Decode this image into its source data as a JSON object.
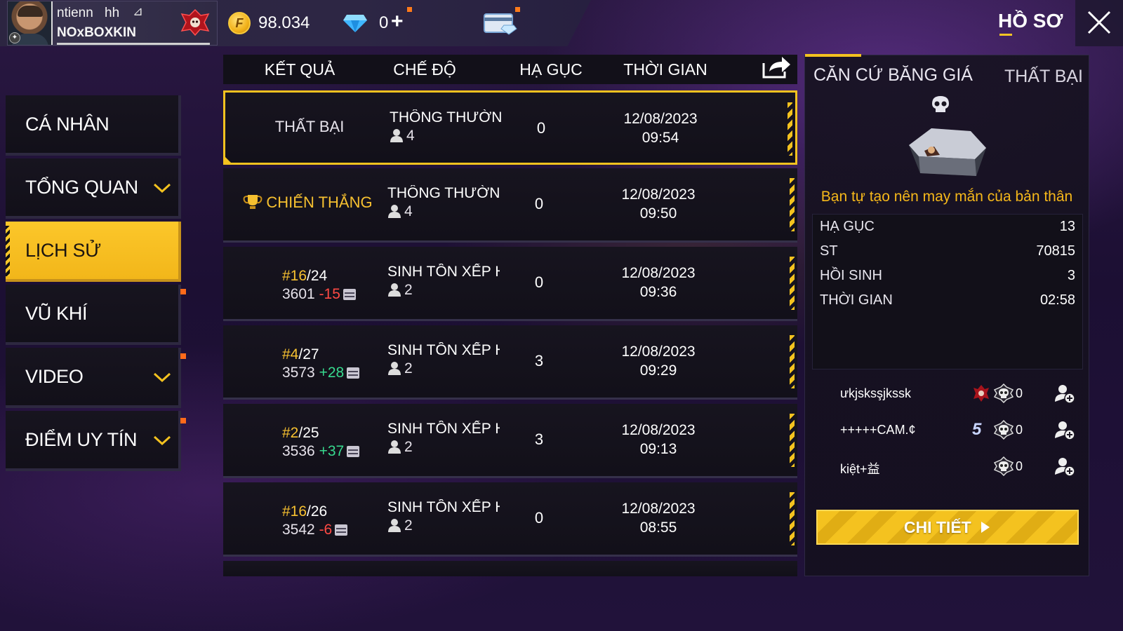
{
  "profile": {
    "name_line1": "ntienn",
    "tag": "hh",
    "name_line2": "NOxBOXKIN"
  },
  "currency": {
    "gold_symbol": "F",
    "gold": "98.034",
    "diamonds": "0",
    "plus": "+"
  },
  "header": {
    "title": "HỒ SƠ"
  },
  "colors": {
    "accent": "#f4c21f",
    "win": "#f6c030",
    "loss_delta": "#ff4a44",
    "gain_delta": "#37d98e"
  },
  "sidebar": {
    "items": [
      {
        "label": "CÁ NHÂN",
        "has_chevron": false,
        "active": false
      },
      {
        "label": "TỔNG QUAN",
        "has_chevron": true,
        "active": false
      },
      {
        "label": "LỊCH SỬ",
        "has_chevron": false,
        "active": true
      },
      {
        "label": "VŨ KHÍ",
        "has_chevron": false,
        "active": false
      },
      {
        "label": "VIDEO",
        "has_chevron": true,
        "active": false
      },
      {
        "label": "ĐIỂM UY TÍN",
        "has_chevron": true,
        "active": false
      }
    ]
  },
  "table": {
    "headers": {
      "result": "KẾT QUẢ",
      "mode": "CHẾ ĐỘ",
      "kills": "HẠ GỤC",
      "time": "THỜI GIAN"
    },
    "rows": [
      {
        "result": "THẤT BẠI",
        "mode": "THÔNG THƯỜNG-SINH TỒN",
        "players": "4",
        "kills": "0",
        "date": "12/08/2023",
        "time": "09:54"
      },
      {
        "result": "CHIẾN THẮNG",
        "mode": "THÔNG THƯỜNG-SINH TỒN",
        "players": "4",
        "kills": "0",
        "date": "12/08/2023",
        "time": "09:50"
      },
      {
        "rank": "#16",
        "total": "/24",
        "points": "3601",
        "delta": "-15",
        "mode": "SINH TỒN XẾP HẠNG",
        "players": "2",
        "kills": "0",
        "date": "12/08/2023",
        "time": "09:36"
      },
      {
        "rank": "#4",
        "total": "/27",
        "points": "3573",
        "delta": "+28",
        "mode": "SINH TỒN XẾP HẠNG",
        "players": "2",
        "kills": "3",
        "date": "12/08/2023",
        "time": "09:29"
      },
      {
        "rank": "#2",
        "total": "/25",
        "points": "3536",
        "delta": "+37",
        "mode": "SINH TỒN XẾP HẠNG",
        "players": "2",
        "kills": "3",
        "date": "12/08/2023",
        "time": "09:13"
      },
      {
        "rank": "#16",
        "total": "/26",
        "points": "3542",
        "delta": "-6",
        "mode": "SINH TỒN XẾP HẠNG",
        "players": "2",
        "kills": "0",
        "date": "12/08/2023",
        "time": "08:55"
      }
    ]
  },
  "match_detail": {
    "map": "CĂN CỨ BĂNG GIÁ",
    "result": "THẤT BẠI",
    "message": "Bạn tự tạo nên may mắn của bản thân",
    "stats": [
      {
        "label": "HẠ GỤC",
        "value": "13"
      },
      {
        "label": "ST",
        "value": "70815"
      },
      {
        "label": "HỒI SINH",
        "value": "3"
      },
      {
        "label": "THỜI GIAN",
        "value": "02:58"
      }
    ],
    "team": [
      {
        "name": "ưkjsksşjkssk",
        "kills": "0",
        "badge": "red-emblem"
      },
      {
        "name": "+++++CAM.¢",
        "kills": "0",
        "badge": "5"
      },
      {
        "name": "kiệt+益",
        "kills": "0",
        "badge": ""
      }
    ],
    "detail_button": "CHI TIẾT"
  }
}
